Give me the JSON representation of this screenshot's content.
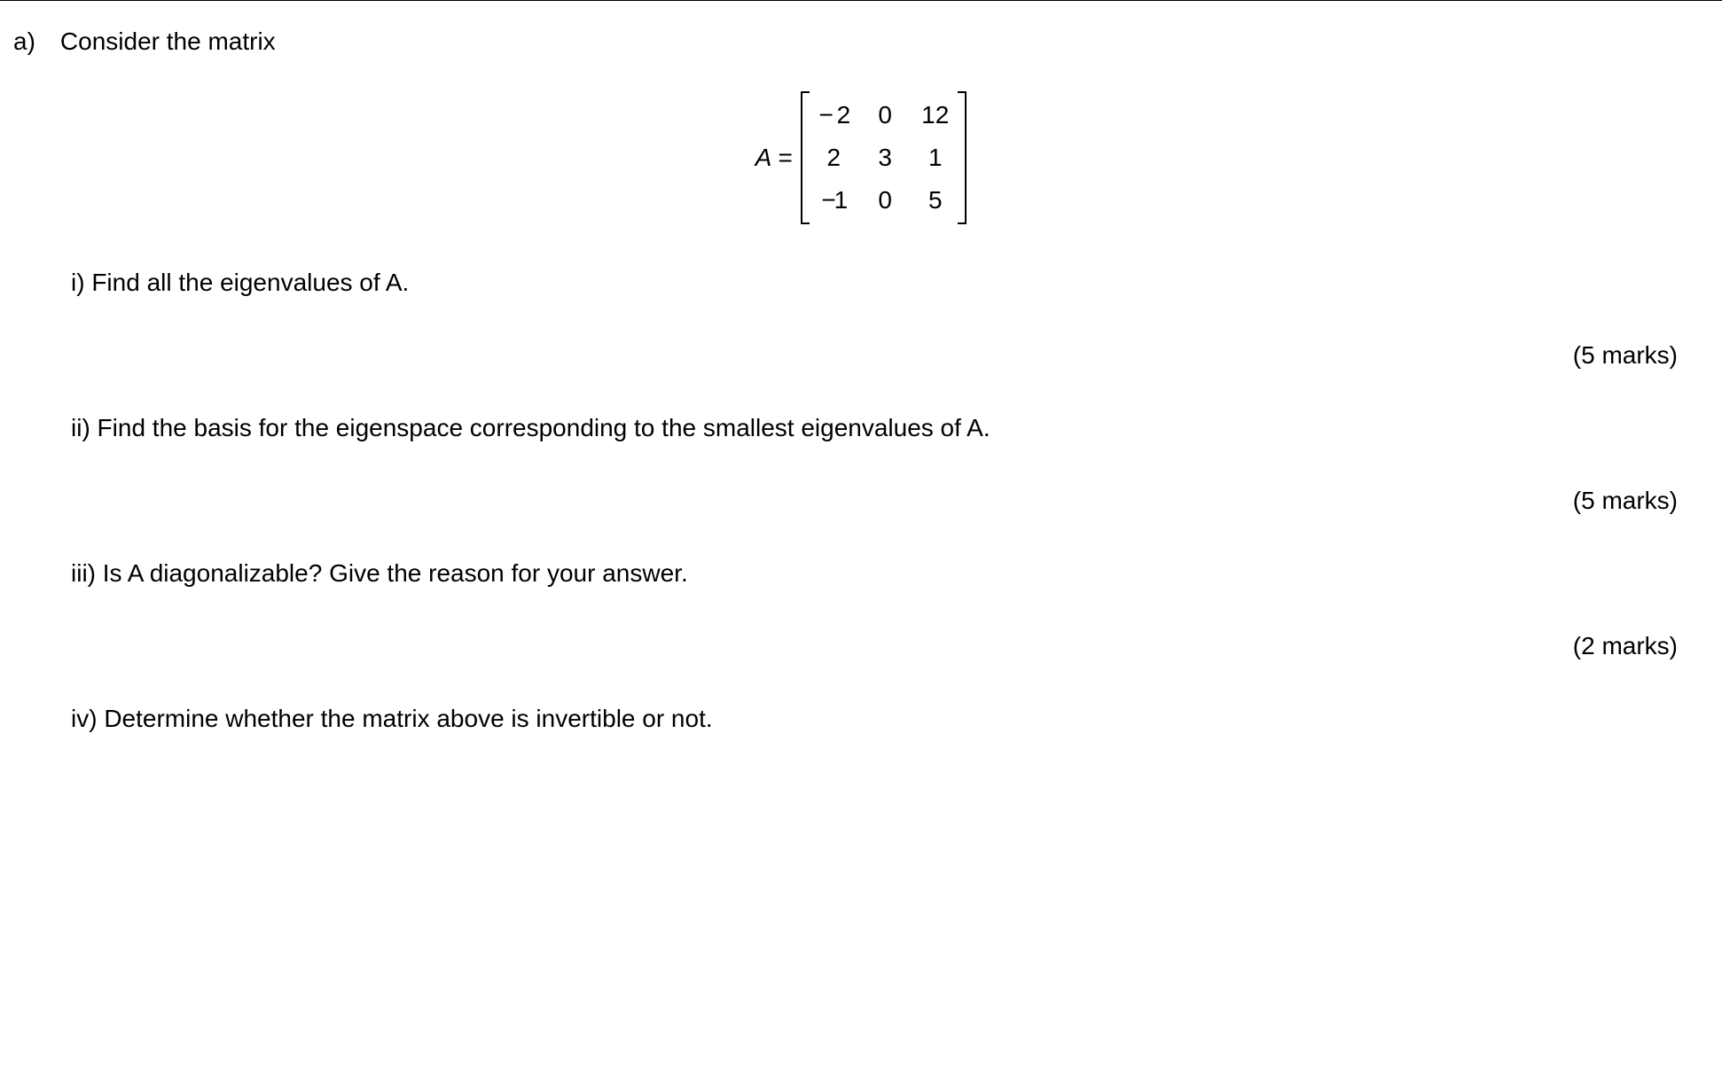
{
  "question": {
    "part_label": "a)",
    "intro": "Consider the matrix",
    "matrix_label": "A =",
    "matrix": {
      "r0c0": "− 2",
      "r0c1": "0",
      "r0c2": "12",
      "r1c0": "2",
      "r1c1": "3",
      "r1c2": "1",
      "r2c0": "−1",
      "r2c1": "0",
      "r2c2": "5"
    },
    "subs": {
      "i": {
        "text": "i) Find all the eigenvalues of A.",
        "marks": "(5 marks)"
      },
      "ii": {
        "text": "ii) Find the basis for the eigenspace corresponding to the smallest eigenvalues of A.",
        "marks": "(5 marks)"
      },
      "iii": {
        "text": "iii) Is A diagonalizable? Give the reason for your answer.",
        "marks": "(2 marks)"
      },
      "iv": {
        "text": "iv) Determine whether the matrix above is invertible or not."
      }
    }
  }
}
